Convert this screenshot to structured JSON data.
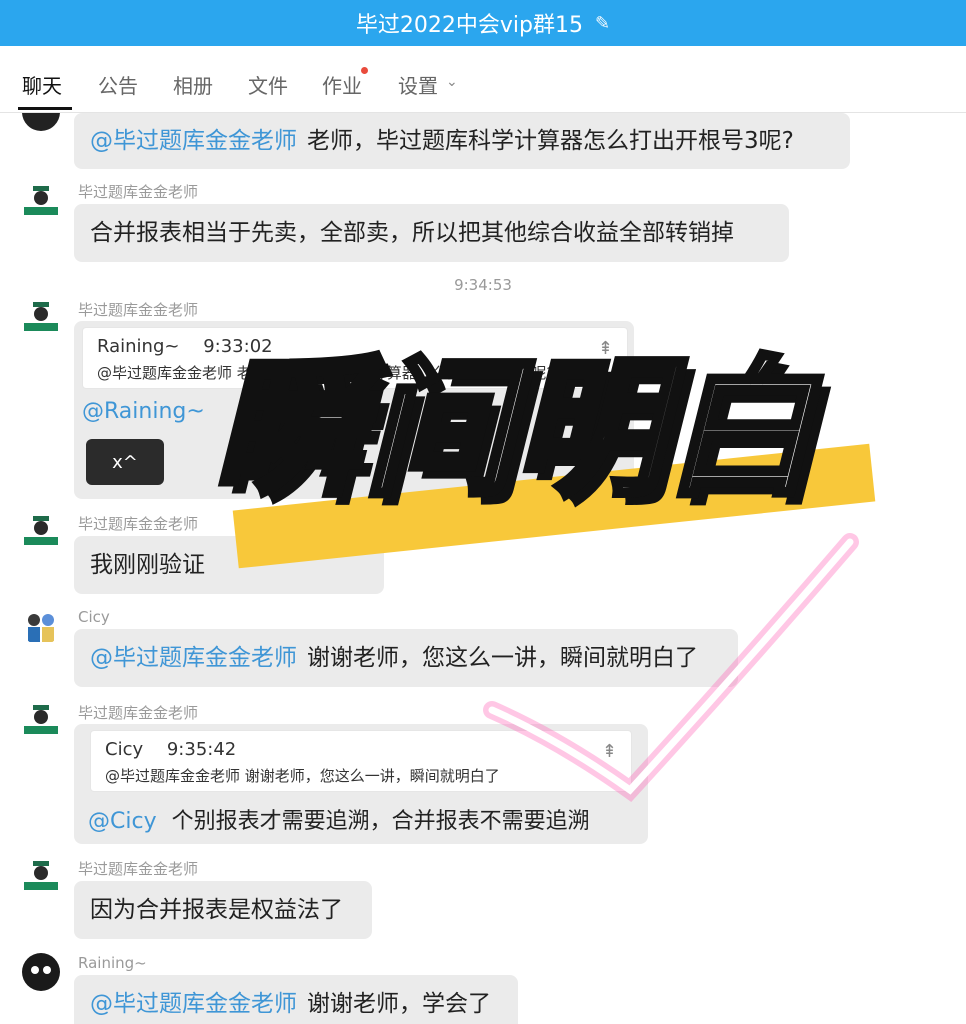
{
  "title": "毕过2022中会vip群15",
  "tabs": [
    {
      "label": "聊天"
    },
    {
      "label": "公告"
    },
    {
      "label": "相册"
    },
    {
      "label": "文件"
    },
    {
      "label": "作业"
    },
    {
      "label": "设置"
    }
  ],
  "messages": [
    {
      "mention": "@毕过题库金金老师",
      "text": "老师，毕过题库科学计算器怎么打出开根号3呢?"
    },
    {
      "sender": "毕过题库金金老师",
      "text": "合并报表相当于先卖，全部卖，所以把其他综合收益全部转销掉"
    },
    {
      "time": "9:34:53"
    },
    {
      "sender": "毕过题库金金老师",
      "quote_user": "Raining~",
      "quote_time": "9:33:02",
      "quote_text": "@毕过题库金金老师 老师，毕过题库科学计算器怎么打出开根号3呢?",
      "mention": "@Raining~",
      "button": "x^"
    },
    {
      "sender": "毕过题库金金老师",
      "text": "我刚刚验证"
    },
    {
      "sender": "Cicy",
      "mention": "@毕过题库金金老师",
      "text": "谢谢老师，您这么一讲，瞬间就明白了"
    },
    {
      "sender": "毕过题库金金老师",
      "quote_user": "Cicy",
      "quote_time": "9:35:42",
      "quote_text": "@毕过题库金金老师 谢谢老师，您这么一讲，瞬间就明白了",
      "mention": "@Cicy",
      "text": "个别报表才需要追溯，合并报表不需要追溯"
    },
    {
      "sender": "毕过题库金金老师",
      "text": "因为合并报表是权益法了"
    },
    {
      "sender": "Raining~",
      "mention": "@毕过题库金金老师",
      "text": "谢谢老师，学会了"
    }
  ],
  "overlay": {
    "text": "瞬间明白"
  },
  "icons": {
    "edit": "edit-pencil-icon",
    "pin": "pin-top-icon",
    "chevron": "chevron-down-icon",
    "checkmark": "checkmark-icon"
  },
  "colors": {
    "header": "#2ba6ee",
    "mention": "#3f96d6",
    "highlight": "#f8c83a",
    "check_glow": "#ff5fb4"
  }
}
